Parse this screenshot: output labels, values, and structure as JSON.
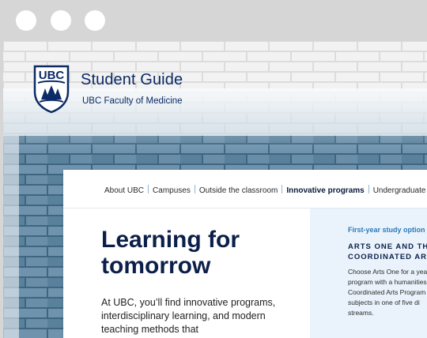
{
  "window": {
    "controls": [
      "window-control",
      "window-control",
      "window-control"
    ]
  },
  "brand": {
    "crest_text": "UBC",
    "title": "Student Guide",
    "subtitle": "UBC Faculty of Medicine"
  },
  "nav": {
    "items": [
      {
        "label": "About UBC",
        "active": false
      },
      {
        "label": "Campuses",
        "active": false
      },
      {
        "label": "Outside the classroom",
        "active": false
      },
      {
        "label": "Innovative programs",
        "active": true
      },
      {
        "label": "Undergraduate d",
        "active": false
      }
    ]
  },
  "hero": {
    "title": "Learning for tomorrow",
    "body": "At UBC, you’ll find innovative programs, interdisciplinary learning, and modern teaching methods that"
  },
  "aside": {
    "eyebrow": "First-year study option",
    "heading": "ARTS ONE AND THE COORDINATED ART",
    "body": "Choose Arts One for a year program with a humanities Coordinated Arts Program subjects in one of five di streams."
  },
  "colors": {
    "brand_navy": "#0b2a66",
    "accent_blue": "#2a7ab8",
    "aside_bg": "#eaf3fb",
    "brick_blue": "#5f84a0"
  }
}
